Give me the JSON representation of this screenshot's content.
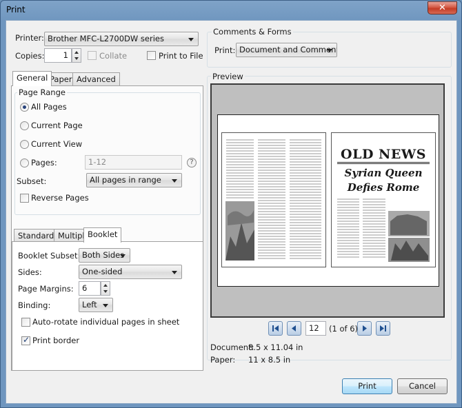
{
  "window": {
    "title": "Print",
    "close_glyph": "✕"
  },
  "printer": {
    "label": "Printer:",
    "value": "Brother MFC-L2700DW series"
  },
  "copies": {
    "label": "Copies:",
    "value": "1"
  },
  "collate": {
    "label": "Collate",
    "checked": false,
    "enabled": false
  },
  "print_to_file": {
    "label": "Print to File",
    "checked": false
  },
  "comments_forms": {
    "group_label": "Comments & Forms",
    "print_label": "Print:",
    "value": "Document and Comments"
  },
  "tabs": [
    {
      "label": "General",
      "active": true
    },
    {
      "label": "Paper",
      "active": false
    },
    {
      "label": "Advanced",
      "active": false
    }
  ],
  "page_range": {
    "group_label": "Page Range",
    "options": [
      {
        "label": "All Pages",
        "checked": true
      },
      {
        "label": "Current Page",
        "checked": false
      },
      {
        "label": "Current View",
        "checked": false
      },
      {
        "label": "Pages:",
        "checked": false
      }
    ],
    "pages_value": "1-12",
    "help_glyph": "?",
    "subset_label": "Subset:",
    "subset_value": "All pages in range",
    "reverse_label": "Reverse Pages"
  },
  "layout_tabs": [
    {
      "label": "Standard",
      "active": false
    },
    {
      "label": "Multiple",
      "active": false
    },
    {
      "label": "Booklet",
      "active": true
    }
  ],
  "booklet": {
    "subset_label": "Booklet Subset:",
    "subset_value": "Both Sides",
    "sides_label": "Sides:",
    "sides_value": "One-sided",
    "margins_label": "Page Margins:",
    "margins_value": "6",
    "binding_label": "Binding:",
    "binding_value": "Left",
    "autorotate_label": "Auto-rotate individual pages in sheet",
    "print_border_label": "Print border"
  },
  "preview": {
    "label": "Preview",
    "headline": "OLD NEWS",
    "subhead_1": "Syrian Queen",
    "subhead_2": "Defies Rome",
    "page_input": "12",
    "page_of": "(1 of 6)",
    "document_label": "Document:",
    "document_value": "8.5 x 11.04 in",
    "paper_label": "Paper:",
    "paper_value": "11 x 8.5 in"
  },
  "buttons": {
    "print": "Print",
    "cancel": "Cancel"
  }
}
